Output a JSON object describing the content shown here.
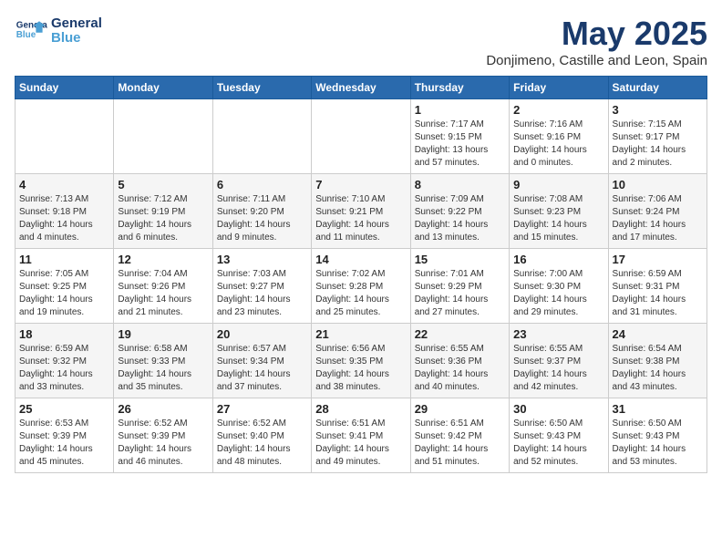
{
  "header": {
    "logo_line1": "General",
    "logo_line2": "Blue",
    "title": "May 2025",
    "subtitle": "Donjimeno, Castille and Leon, Spain"
  },
  "weekdays": [
    "Sunday",
    "Monday",
    "Tuesday",
    "Wednesday",
    "Thursday",
    "Friday",
    "Saturday"
  ],
  "weeks": [
    [
      {
        "day": "",
        "info": ""
      },
      {
        "day": "",
        "info": ""
      },
      {
        "day": "",
        "info": ""
      },
      {
        "day": "",
        "info": ""
      },
      {
        "day": "1",
        "info": "Sunrise: 7:17 AM\nSunset: 9:15 PM\nDaylight: 13 hours\nand 57 minutes."
      },
      {
        "day": "2",
        "info": "Sunrise: 7:16 AM\nSunset: 9:16 PM\nDaylight: 14 hours\nand 0 minutes."
      },
      {
        "day": "3",
        "info": "Sunrise: 7:15 AM\nSunset: 9:17 PM\nDaylight: 14 hours\nand 2 minutes."
      }
    ],
    [
      {
        "day": "4",
        "info": "Sunrise: 7:13 AM\nSunset: 9:18 PM\nDaylight: 14 hours\nand 4 minutes."
      },
      {
        "day": "5",
        "info": "Sunrise: 7:12 AM\nSunset: 9:19 PM\nDaylight: 14 hours\nand 6 minutes."
      },
      {
        "day": "6",
        "info": "Sunrise: 7:11 AM\nSunset: 9:20 PM\nDaylight: 14 hours\nand 9 minutes."
      },
      {
        "day": "7",
        "info": "Sunrise: 7:10 AM\nSunset: 9:21 PM\nDaylight: 14 hours\nand 11 minutes."
      },
      {
        "day": "8",
        "info": "Sunrise: 7:09 AM\nSunset: 9:22 PM\nDaylight: 14 hours\nand 13 minutes."
      },
      {
        "day": "9",
        "info": "Sunrise: 7:08 AM\nSunset: 9:23 PM\nDaylight: 14 hours\nand 15 minutes."
      },
      {
        "day": "10",
        "info": "Sunrise: 7:06 AM\nSunset: 9:24 PM\nDaylight: 14 hours\nand 17 minutes."
      }
    ],
    [
      {
        "day": "11",
        "info": "Sunrise: 7:05 AM\nSunset: 9:25 PM\nDaylight: 14 hours\nand 19 minutes."
      },
      {
        "day": "12",
        "info": "Sunrise: 7:04 AM\nSunset: 9:26 PM\nDaylight: 14 hours\nand 21 minutes."
      },
      {
        "day": "13",
        "info": "Sunrise: 7:03 AM\nSunset: 9:27 PM\nDaylight: 14 hours\nand 23 minutes."
      },
      {
        "day": "14",
        "info": "Sunrise: 7:02 AM\nSunset: 9:28 PM\nDaylight: 14 hours\nand 25 minutes."
      },
      {
        "day": "15",
        "info": "Sunrise: 7:01 AM\nSunset: 9:29 PM\nDaylight: 14 hours\nand 27 minutes."
      },
      {
        "day": "16",
        "info": "Sunrise: 7:00 AM\nSunset: 9:30 PM\nDaylight: 14 hours\nand 29 minutes."
      },
      {
        "day": "17",
        "info": "Sunrise: 6:59 AM\nSunset: 9:31 PM\nDaylight: 14 hours\nand 31 minutes."
      }
    ],
    [
      {
        "day": "18",
        "info": "Sunrise: 6:59 AM\nSunset: 9:32 PM\nDaylight: 14 hours\nand 33 minutes."
      },
      {
        "day": "19",
        "info": "Sunrise: 6:58 AM\nSunset: 9:33 PM\nDaylight: 14 hours\nand 35 minutes."
      },
      {
        "day": "20",
        "info": "Sunrise: 6:57 AM\nSunset: 9:34 PM\nDaylight: 14 hours\nand 37 minutes."
      },
      {
        "day": "21",
        "info": "Sunrise: 6:56 AM\nSunset: 9:35 PM\nDaylight: 14 hours\nand 38 minutes."
      },
      {
        "day": "22",
        "info": "Sunrise: 6:55 AM\nSunset: 9:36 PM\nDaylight: 14 hours\nand 40 minutes."
      },
      {
        "day": "23",
        "info": "Sunrise: 6:55 AM\nSunset: 9:37 PM\nDaylight: 14 hours\nand 42 minutes."
      },
      {
        "day": "24",
        "info": "Sunrise: 6:54 AM\nSunset: 9:38 PM\nDaylight: 14 hours\nand 43 minutes."
      }
    ],
    [
      {
        "day": "25",
        "info": "Sunrise: 6:53 AM\nSunset: 9:39 PM\nDaylight: 14 hours\nand 45 minutes."
      },
      {
        "day": "26",
        "info": "Sunrise: 6:52 AM\nSunset: 9:39 PM\nDaylight: 14 hours\nand 46 minutes."
      },
      {
        "day": "27",
        "info": "Sunrise: 6:52 AM\nSunset: 9:40 PM\nDaylight: 14 hours\nand 48 minutes."
      },
      {
        "day": "28",
        "info": "Sunrise: 6:51 AM\nSunset: 9:41 PM\nDaylight: 14 hours\nand 49 minutes."
      },
      {
        "day": "29",
        "info": "Sunrise: 6:51 AM\nSunset: 9:42 PM\nDaylight: 14 hours\nand 51 minutes."
      },
      {
        "day": "30",
        "info": "Sunrise: 6:50 AM\nSunset: 9:43 PM\nDaylight: 14 hours\nand 52 minutes."
      },
      {
        "day": "31",
        "info": "Sunrise: 6:50 AM\nSunset: 9:43 PM\nDaylight: 14 hours\nand 53 minutes."
      }
    ]
  ]
}
